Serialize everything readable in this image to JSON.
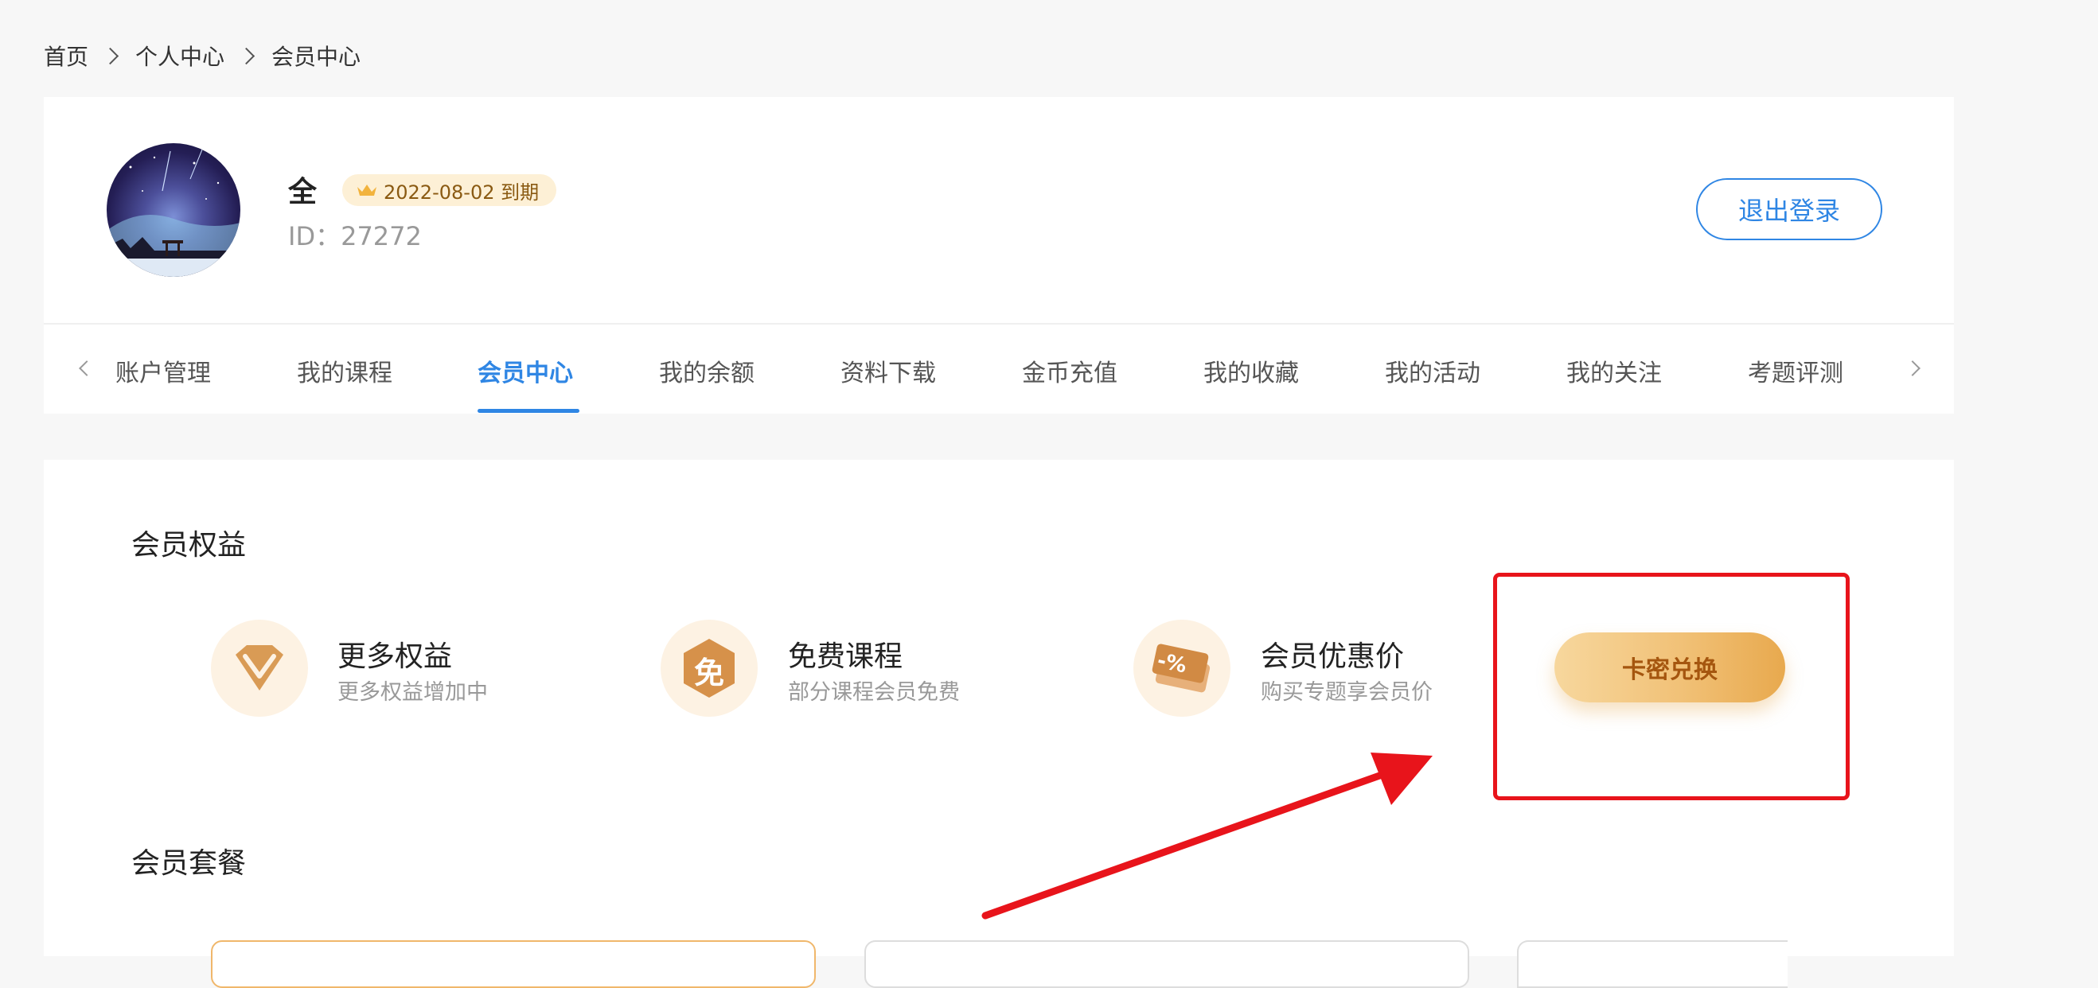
{
  "breadcrumb": [
    "首页",
    "个人中心",
    "会员中心"
  ],
  "user": {
    "name": "全",
    "vip_expiry": "2022-08-02 到期",
    "id_text": "ID：27272"
  },
  "logout_label": "退出登录",
  "tabs": [
    {
      "label": "账户管理",
      "active": false
    },
    {
      "label": "我的课程",
      "active": false
    },
    {
      "label": "会员中心",
      "active": true
    },
    {
      "label": "我的余额",
      "active": false
    },
    {
      "label": "资料下载",
      "active": false
    },
    {
      "label": "金币充值",
      "active": false
    },
    {
      "label": "我的收藏",
      "active": false
    },
    {
      "label": "我的活动",
      "active": false
    },
    {
      "label": "我的关注",
      "active": false
    },
    {
      "label": "考题评测",
      "active": false
    }
  ],
  "benefits_section": {
    "title": "会员权益",
    "items": [
      {
        "icon": "diamond-icon",
        "title": "更多权益",
        "desc": "更多权益增加中"
      },
      {
        "icon": "free-icon",
        "glyph": "免",
        "title": "免费课程",
        "desc": "部分课程会员免费"
      },
      {
        "icon": "discount-ticket-icon",
        "glyph": "-%",
        "title": "会员优惠价",
        "desc": "购买专题享会员价"
      }
    ],
    "redeem_label": "卡密兑换"
  },
  "packages_section": {
    "title": "会员套餐"
  },
  "colors": {
    "accent_blue": "#2f86e4",
    "gold": "#f1c177",
    "highlight_red": "#e8141b"
  }
}
